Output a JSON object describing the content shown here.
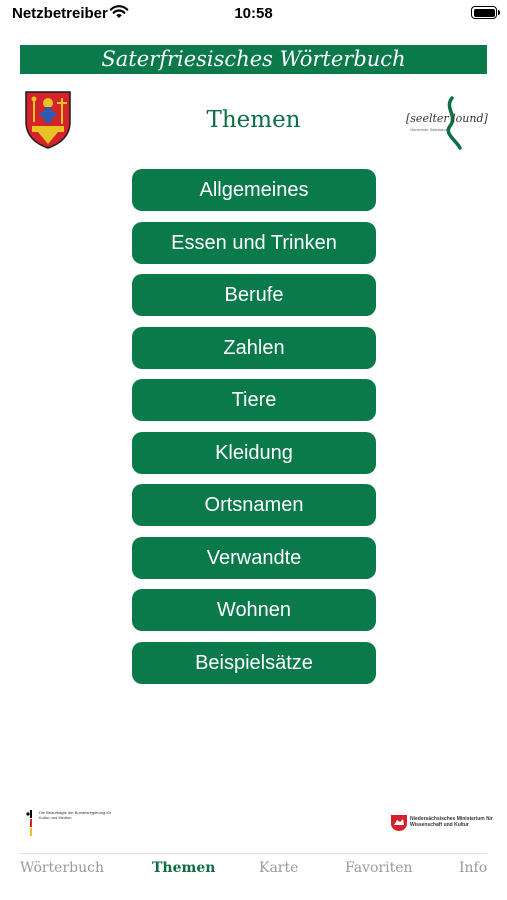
{
  "status_bar": {
    "carrier": "Netzbetreiber",
    "time": "10:58"
  },
  "header": {
    "app_title": "Saterfriesisches Wörterbuch",
    "page_title": "Themen",
    "partner_logo_text": "[seelter lound]",
    "partner_logo_subtext": "Gemeinde Saterland"
  },
  "topics": [
    {
      "label": "Allgemeines"
    },
    {
      "label": "Essen und Trinken"
    },
    {
      "label": "Berufe"
    },
    {
      "label": "Zahlen"
    },
    {
      "label": "Tiere"
    },
    {
      "label": "Kleidung"
    },
    {
      "label": "Ortsnamen"
    },
    {
      "label": "Verwandte"
    },
    {
      "label": "Wohnen"
    },
    {
      "label": "Beispielsätze"
    }
  ],
  "sponsors": {
    "federal": "Die Beauftragte der Bundesregierung für Kultur und Medien",
    "state": "Niedersächsisches Ministerium für Wissenschaft und Kultur"
  },
  "tabs": [
    {
      "label": "Wörterbuch",
      "active": false
    },
    {
      "label": "Themen",
      "active": true
    },
    {
      "label": "Karte",
      "active": false
    },
    {
      "label": "Favoriten",
      "active": false
    },
    {
      "label": "Info",
      "active": false
    }
  ],
  "colors": {
    "accent": "#0b7a4b",
    "active_tab": "#0b6e44",
    "inactive_tab": "#9a9a9a"
  }
}
